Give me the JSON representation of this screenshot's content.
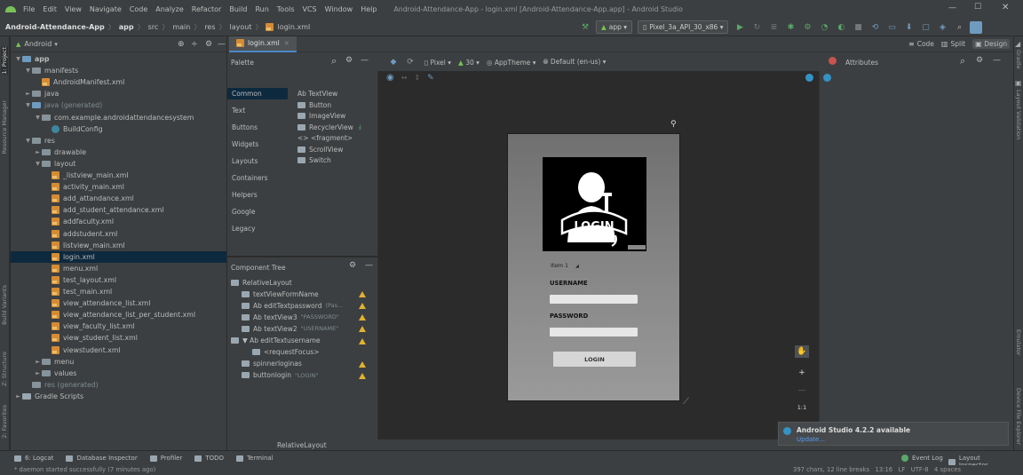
{
  "menu": [
    "File",
    "Edit",
    "View",
    "Navigate",
    "Code",
    "Analyze",
    "Refactor",
    "Build",
    "Run",
    "Tools",
    "VCS",
    "Window",
    "Help"
  ],
  "window_title": "Android-Attendance-App - login.xml [Android-Attendance-App.app] - Android Studio",
  "breadcrumbs": [
    "Android-Attendance-App",
    "app",
    "src",
    "main",
    "res",
    "layout",
    "login.xml"
  ],
  "run_config": "app",
  "device": "Pixel_3a_API_30_x86",
  "project_view": "Android",
  "left_stripe": [
    "1: Project",
    "Resource Manager",
    "Build Variants",
    "Z: Structure",
    "2: Favorites"
  ],
  "right_stripe": [
    "Gradle",
    "Layout Validation",
    "Emulator",
    "Device File Explorer"
  ],
  "tree": [
    {
      "label": "app",
      "indent": 0,
      "kind": "folder-blue",
      "arrow": "▼",
      "bold": true
    },
    {
      "label": "manifests",
      "indent": 1,
      "kind": "folder",
      "arrow": "▼"
    },
    {
      "label": "AndroidManifest.xml",
      "indent": 2,
      "kind": "xml",
      "arrow": ""
    },
    {
      "label": "java",
      "indent": 1,
      "kind": "folder",
      "arrow": "►"
    },
    {
      "label": "java (generated)",
      "indent": 1,
      "kind": "folder-blue",
      "arrow": "▼",
      "gray": true
    },
    {
      "label": "com.example.androidattendancesystem",
      "indent": 2,
      "kind": "folder",
      "arrow": "▼"
    },
    {
      "label": "BuildConfig",
      "indent": 3,
      "kind": "class",
      "arrow": ""
    },
    {
      "label": "res",
      "indent": 1,
      "kind": "folder",
      "arrow": "▼"
    },
    {
      "label": "drawable",
      "indent": 2,
      "kind": "folder",
      "arrow": "►"
    },
    {
      "label": "layout",
      "indent": 2,
      "kind": "folder",
      "arrow": "▼"
    },
    {
      "label": "_listview_main.xml",
      "indent": 3,
      "kind": "xml",
      "arrow": ""
    },
    {
      "label": "activity_main.xml",
      "indent": 3,
      "kind": "xml",
      "arrow": ""
    },
    {
      "label": "add_attandance.xml",
      "indent": 3,
      "kind": "xml",
      "arrow": ""
    },
    {
      "label": "add_student_attendance.xml",
      "indent": 3,
      "kind": "xml",
      "arrow": ""
    },
    {
      "label": "addfaculty.xml",
      "indent": 3,
      "kind": "xml",
      "arrow": ""
    },
    {
      "label": "addstudent.xml",
      "indent": 3,
      "kind": "xml",
      "arrow": ""
    },
    {
      "label": "listview_main.xml",
      "indent": 3,
      "kind": "xml",
      "arrow": ""
    },
    {
      "label": "login.xml",
      "indent": 3,
      "kind": "xml",
      "arrow": "",
      "selected": true
    },
    {
      "label": "menu.xml",
      "indent": 3,
      "kind": "xml",
      "arrow": ""
    },
    {
      "label": "test_layout.xml",
      "indent": 3,
      "kind": "xml",
      "arrow": ""
    },
    {
      "label": "test_main.xml",
      "indent": 3,
      "kind": "xml",
      "arrow": ""
    },
    {
      "label": "view_attendance_list.xml",
      "indent": 3,
      "kind": "xml",
      "arrow": ""
    },
    {
      "label": "view_attendance_list_per_student.xml",
      "indent": 3,
      "kind": "xml",
      "arrow": ""
    },
    {
      "label": "view_faculty_list.xml",
      "indent": 3,
      "kind": "xml",
      "arrow": ""
    },
    {
      "label": "view_student_list.xml",
      "indent": 3,
      "kind": "xml",
      "arrow": ""
    },
    {
      "label": "viewstudent.xml",
      "indent": 3,
      "kind": "xml",
      "arrow": ""
    },
    {
      "label": "menu",
      "indent": 2,
      "kind": "folder",
      "arrow": "►"
    },
    {
      "label": "values",
      "indent": 2,
      "kind": "folder",
      "arrow": "►"
    },
    {
      "label": "res (generated)",
      "indent": 1,
      "kind": "folder",
      "arrow": "",
      "gray": true
    },
    {
      "label": "Gradle Scripts",
      "indent": 0,
      "kind": "gradle",
      "arrow": "►"
    }
  ],
  "editor_tab": "login.xml",
  "view_modes": [
    "Code",
    "Split",
    "Design"
  ],
  "design_toolbar": {
    "device": "Pixel",
    "api": "30",
    "theme": "AppTheme",
    "locale": "Default (en-us)"
  },
  "palette": {
    "title": "Palette",
    "categories": [
      "Common",
      "Text",
      "Buttons",
      "Widgets",
      "Layouts",
      "Containers",
      "Helpers",
      "Google",
      "Legacy"
    ],
    "items": [
      "Ab TextView",
      "Button",
      "ImageView",
      "RecyclerView",
      "<> <fragment>",
      "ScrollView",
      "Switch"
    ]
  },
  "component_tree": {
    "title": "Component Tree",
    "items": [
      {
        "label": "RelativeLayout",
        "indent": 0,
        "warn": false
      },
      {
        "label": "textViewFormName",
        "indent": 1,
        "warn": true
      },
      {
        "label": "Ab editTextpassword",
        "hint": "(Pas...",
        "indent": 1,
        "warn": true
      },
      {
        "label": "Ab textView3",
        "hint": "\"PASSWORD\"",
        "indent": 1,
        "warn": true
      },
      {
        "label": "Ab textView2",
        "hint": "\"USERNAME\"",
        "indent": 1,
        "warn": true
      },
      {
        "label": "▼ Ab editTextusername",
        "indent": 0,
        "warn": true
      },
      {
        "label": "<requestFocus>",
        "indent": 2,
        "warn": false
      },
      {
        "label": "spinnerloginas",
        "indent": 1,
        "warn": true
      },
      {
        "label": "buttonlogin",
        "hint": "\"LOGIN\"",
        "indent": 1,
        "warn": true
      }
    ]
  },
  "phone": {
    "logo_text": "LOGIN",
    "spinner_item": "Item 1",
    "username_label": "USERNAME",
    "password_label": "PASSWORD",
    "login_button": "LOGIN"
  },
  "zoom_label": "1:1",
  "attributes_title": "Attributes",
  "breadcrumb_bottom": "RelativeLayout",
  "notification": {
    "title": "Android Studio 4.2.2 available",
    "link": "Update..."
  },
  "bottom_tools": [
    "6: Logcat",
    "Database Inspector",
    "Profiler",
    "TODO",
    "Terminal"
  ],
  "bottom_tools_right": [
    "Event Log",
    "Layout Inspector"
  ],
  "status": {
    "message": "* daemon started successfully (7 minutes ago)",
    "right": "397 chars, 12 line breaks   13:16   LF   UTF-8   4 spaces"
  },
  "colors": {
    "accent": "#4a88c7",
    "warn": "#e0b230",
    "error": "#c75450",
    "selection": "#0d293e"
  }
}
